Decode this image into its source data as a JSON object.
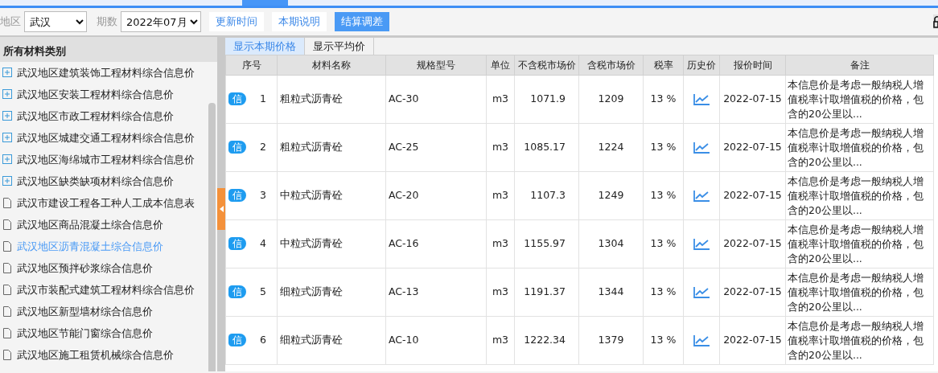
{
  "toolbar": {
    "region_label": "地区",
    "region": "武汉",
    "period_label": "期数",
    "period": "2022年07月",
    "buttons": [
      {
        "label": "更新时间",
        "kind": "plain"
      },
      {
        "label": "本期说明",
        "kind": "plain"
      },
      {
        "label": "结算调差",
        "kind": "primary"
      }
    ]
  },
  "sidebar": {
    "title": "所有材料类别",
    "items": [
      {
        "label": "武汉地区建筑装饰工程材料综合信息价",
        "kind": "group",
        "selected": false
      },
      {
        "label": "武汉地区安装工程材料综合信息价",
        "kind": "group",
        "selected": false
      },
      {
        "label": "武汉地区市政工程材料综合信息价",
        "kind": "group",
        "selected": false
      },
      {
        "label": "武汉地区城建交通工程材料综合信息价",
        "kind": "group",
        "selected": false
      },
      {
        "label": "武汉地区海绵城市工程材料综合信息价",
        "kind": "group",
        "selected": false
      },
      {
        "label": "武汉地区缺类缺项材料综合信息价",
        "kind": "group",
        "selected": false
      },
      {
        "label": "武汉市建设工程各工种人工成本信息表",
        "kind": "leaf",
        "selected": false
      },
      {
        "label": "武汉地区商品混凝土综合信息价",
        "kind": "leaf",
        "selected": false
      },
      {
        "label": "武汉地区沥青混凝土综合信息价",
        "kind": "leaf",
        "selected": true
      },
      {
        "label": "武汉地区预拌砂浆综合信息价",
        "kind": "leaf",
        "selected": false
      },
      {
        "label": "武汉市装配式建筑工程材料综合信息价",
        "kind": "leaf",
        "selected": false
      },
      {
        "label": "武汉地区新型墙材综合信息价",
        "kind": "leaf",
        "selected": false
      },
      {
        "label": "武汉地区节能门窗综合信息价",
        "kind": "leaf",
        "selected": false
      },
      {
        "label": "武汉地区施工租赁机械综合信息价",
        "kind": "leaf",
        "selected": false
      }
    ]
  },
  "view_tabs": [
    {
      "label": "显示本期价格",
      "selected": true
    },
    {
      "label": "显示平均价",
      "selected": false
    }
  ],
  "table": {
    "columns": [
      "序号",
      "材料名称",
      "规格型号",
      "单位",
      "不含税市场价",
      "含税市场价",
      "税率",
      "历史价",
      "报价时间",
      "备注"
    ],
    "rows": [
      {
        "badge": "信",
        "no": "1",
        "name": "粗粒式沥青砼",
        "spec": "AC-30",
        "unit": "m3",
        "price_ex_tax": "1071.9",
        "price_inc_tax": "1209",
        "tax_rate": "13 %",
        "date": "2022-07-15",
        "note": "本信息价是考虑一般纳税人增值税率计取增值税的价格，包含的20公里以..."
      },
      {
        "badge": "信",
        "no": "2",
        "name": "粗粒式沥青砼",
        "spec": "AC-25",
        "unit": "m3",
        "price_ex_tax": "1085.17",
        "price_inc_tax": "1224",
        "tax_rate": "13 %",
        "date": "2022-07-15",
        "note": "本信息价是考虑一般纳税人增值税率计取增值税的价格，包含的20公里以..."
      },
      {
        "badge": "信",
        "no": "3",
        "name": "中粒式沥青砼",
        "spec": "AC-20",
        "unit": "m3",
        "price_ex_tax": "1107.3",
        "price_inc_tax": "1249",
        "tax_rate": "13 %",
        "date": "2022-07-15",
        "note": "本信息价是考虑一般纳税人增值税率计取增值税的价格，包含的20公里以..."
      },
      {
        "badge": "信",
        "no": "4",
        "name": "中粒式沥青砼",
        "spec": "AC-16",
        "unit": "m3",
        "price_ex_tax": "1155.97",
        "price_inc_tax": "1304",
        "tax_rate": "13 %",
        "date": "2022-07-15",
        "note": "本信息价是考虑一般纳税人增值税率计取增值税的价格，包含的20公里以..."
      },
      {
        "badge": "信",
        "no": "5",
        "name": "细粒式沥青砼",
        "spec": "AC-13",
        "unit": "m3",
        "price_ex_tax": "1191.37",
        "price_inc_tax": "1344",
        "tax_rate": "13 %",
        "date": "2022-07-15",
        "note": "本信息价是考虑一般纳税人增值税率计取增值税的价格，包含的20公里以..."
      },
      {
        "badge": "信",
        "no": "6",
        "name": "细粒式沥青砼",
        "spec": "AC-10",
        "unit": "m3",
        "price_ex_tax": "1222.34",
        "price_inc_tax": "1379",
        "tax_rate": "13 %",
        "date": "2022-07-15",
        "note": "本信息价是考虑一般纳税人增值税率计取增值税的价格，包含的20公里以..."
      }
    ]
  }
}
